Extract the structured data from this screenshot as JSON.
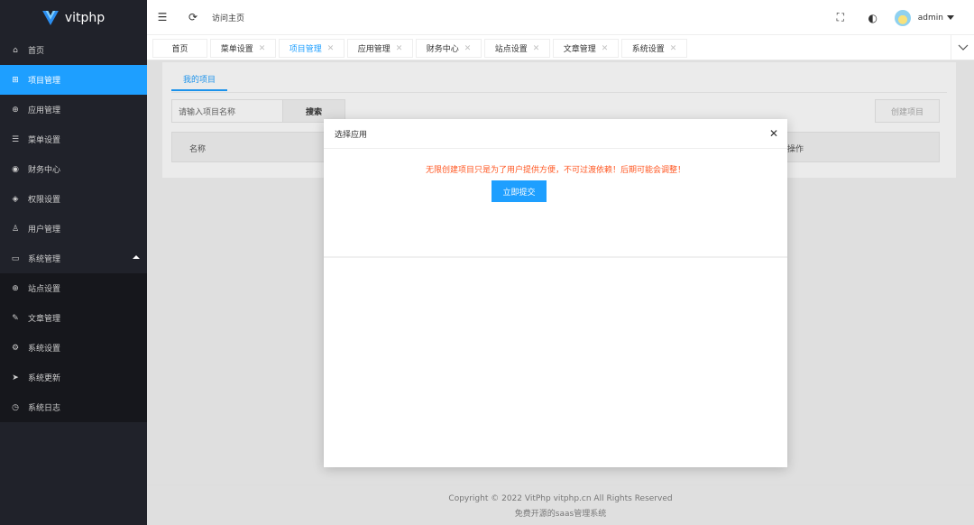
{
  "brand": {
    "name": "vitphp"
  },
  "sidebar": {
    "items": [
      {
        "label": "首页",
        "icon": "home-icon",
        "glyph": "⌂",
        "active": false
      },
      {
        "label": "项目管理",
        "icon": "grid-icon",
        "glyph": "⊞",
        "active": true
      },
      {
        "label": "应用管理",
        "icon": "globe-icon",
        "glyph": "⊕",
        "active": false
      },
      {
        "label": "菜单设置",
        "icon": "list-icon",
        "glyph": "☰",
        "active": false
      },
      {
        "label": "财务中心",
        "icon": "currency-icon",
        "glyph": "◉",
        "active": false
      },
      {
        "label": "权限设置",
        "icon": "key-icon",
        "glyph": "◈",
        "active": false
      },
      {
        "label": "用户管理",
        "icon": "user-icon",
        "glyph": "♙",
        "active": false
      },
      {
        "label": "系统管理",
        "icon": "monitor-icon",
        "glyph": "▭",
        "active": false
      }
    ],
    "subitems": [
      {
        "label": "站点设置",
        "icon": "globe-icon",
        "glyph": "⊕"
      },
      {
        "label": "文章管理",
        "icon": "edit-icon",
        "glyph": "✎"
      },
      {
        "label": "系统设置",
        "icon": "gear-icon",
        "glyph": "⚙"
      },
      {
        "label": "系统更新",
        "icon": "send-icon",
        "glyph": "➤"
      },
      {
        "label": "系统日志",
        "icon": "clock-icon",
        "glyph": "◷"
      }
    ]
  },
  "header": {
    "visit_home": "访问主页",
    "user": "admin"
  },
  "tabs": [
    {
      "label": "首页",
      "closable": false,
      "active": false
    },
    {
      "label": "菜单设置",
      "closable": true,
      "active": false
    },
    {
      "label": "项目管理",
      "closable": true,
      "active": true
    },
    {
      "label": "应用管理",
      "closable": true,
      "active": false
    },
    {
      "label": "财务中心",
      "closable": true,
      "active": false
    },
    {
      "label": "站点设置",
      "closable": true,
      "active": false
    },
    {
      "label": "文章管理",
      "closable": true,
      "active": false
    },
    {
      "label": "系统设置",
      "closable": true,
      "active": false
    }
  ],
  "content": {
    "tab_label": "我的项目",
    "search_placeholder": "请输入项目名称",
    "search_button": "搜索",
    "create_button": "创建项目",
    "columns": {
      "name": "名称",
      "op": "操作"
    }
  },
  "modal": {
    "title": "选择应用",
    "message": "无限创建项目只是为了用户提供方便，不可过渡依赖！后期可能会调整！",
    "submit": "立即提交"
  },
  "footer": {
    "copyright": "Copyright © 2022 VitPhp vitphp.cn All Rights Reserved",
    "tagline": "免费开源的saas管理系统"
  }
}
